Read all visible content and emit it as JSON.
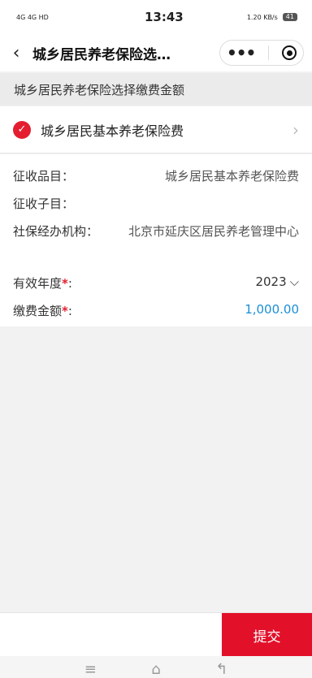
{
  "status_bar": {
    "left": "4G 4G HD",
    "time": "13:43",
    "net_speed": "1.20 KB/s",
    "battery": "41"
  },
  "navbar": {
    "back_icon": "chevron-left-icon",
    "title": "城乡居民养老保险选…",
    "more_icon": "more-dots-icon",
    "target_icon": "target-icon"
  },
  "section": {
    "title": "城乡居民养老保险选择缴费金额"
  },
  "item": {
    "label": "城乡居民基本养老保险费",
    "check_icon": "check-icon",
    "chevron_icon": "chevron-right-icon"
  },
  "details": {
    "collect_item_label": "征收品目：",
    "collect_item_value": "城乡居民基本养老保险费",
    "collect_sub_label": "征收子目：",
    "collect_sub_value": "",
    "agency_label": "社保经办机构：",
    "agency_value": "北京市延庆区居民养老管理中心",
    "year_label": "有效年度",
    "year_req": "*",
    "year_colon": ":",
    "year_value": "2023",
    "amount_label": "缴费金额",
    "amount_req": "*",
    "amount_colon": ":",
    "amount_value": "1,000.00"
  },
  "bottom": {
    "submit_label": "提交"
  },
  "colors": {
    "accent": "#e3102a",
    "amount": "#1a8fd8"
  }
}
